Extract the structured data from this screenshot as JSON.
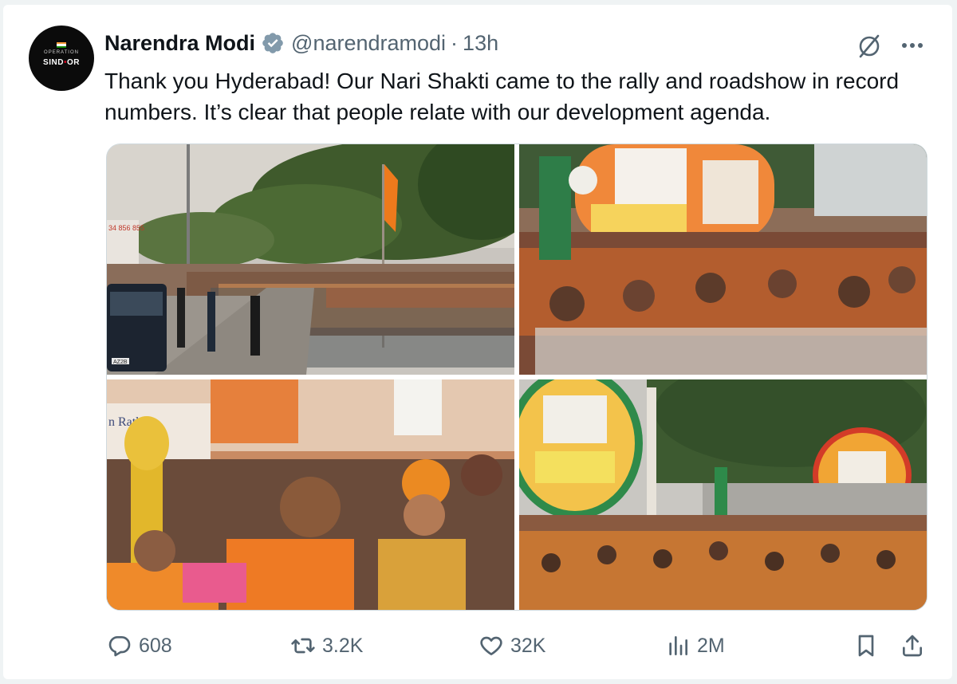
{
  "author": {
    "name": "Narendra Modi",
    "handle": "@narendramodi",
    "separator": "·",
    "time": "13h",
    "avatar_text_top": "OPERATION",
    "avatar_text_main_a": "SIND",
    "avatar_text_main_b": "OR",
    "avatar_text_dot": "•"
  },
  "tweet": {
    "text": "Thank you Hyderabad! Our Nari Shakti came to the rally and roadshow in record numbers. It’s clear that people relate with our development agenda."
  },
  "photos": {
    "p1_plate": "AZ2B",
    "p1_sign": "34 856 855",
    "p3_sign": "n Rathn"
  },
  "actions": {
    "replies": "608",
    "reposts": "3.2K",
    "likes": "32K",
    "views": "2M"
  },
  "icons": {
    "verified": "verified-badge-icon",
    "grok": "grok-icon",
    "more": "more-icon",
    "reply": "reply-icon",
    "repost": "repost-icon",
    "like": "like-icon",
    "views": "views-icon",
    "bookmark": "bookmark-icon",
    "share": "share-icon"
  },
  "colors": {
    "background": "#eff3f4",
    "card": "#ffffff",
    "text": "#0f1419",
    "secondary": "#536471",
    "verified": "#829aab",
    "saffron": "#ef7d1a"
  }
}
